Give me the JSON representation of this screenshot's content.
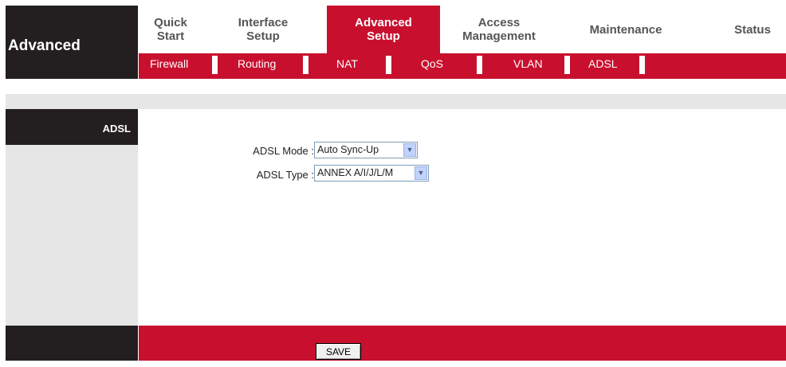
{
  "brand": {
    "title": "Advanced"
  },
  "main_tabs": [
    {
      "label": "Quick\nStart"
    },
    {
      "label": "Interface\nSetup"
    },
    {
      "label": "Advanced\nSetup",
      "active": true
    },
    {
      "label": "Access\nManagement"
    },
    {
      "label": "Maintenance"
    },
    {
      "label": "Status"
    }
  ],
  "sub_tabs": [
    {
      "label": "Firewall"
    },
    {
      "label": "Routing"
    },
    {
      "label": "NAT"
    },
    {
      "label": "QoS"
    },
    {
      "label": "VLAN"
    },
    {
      "label": "ADSL",
      "active": true
    }
  ],
  "section": {
    "title": "ADSL"
  },
  "form": {
    "adsl_mode": {
      "label": "ADSL Mode :",
      "value": "Auto Sync-Up"
    },
    "adsl_type": {
      "label": "ADSL Type :",
      "value": "ANNEX A/I/J/L/M"
    }
  },
  "footer": {
    "save_label": "SAVE"
  },
  "colors": {
    "accent": "#c8102e",
    "dark": "#231f20",
    "panel": "#e6e6e6"
  }
}
